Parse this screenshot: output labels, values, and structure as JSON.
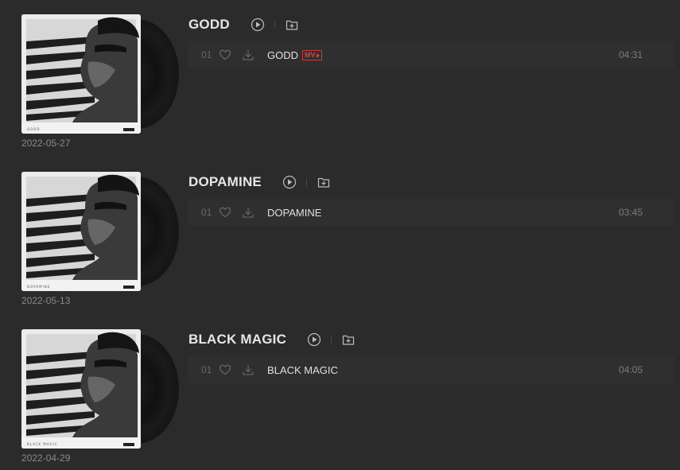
{
  "albums": [
    {
      "title": "GODD",
      "cover_caption": "GODD",
      "release_date": "2022-05-27",
      "tracks": [
        {
          "number": "01",
          "name": "GODD",
          "has_mv": true,
          "mv_label": "MV",
          "duration": "04:31"
        }
      ]
    },
    {
      "title": "DOPAMINE",
      "cover_caption": "DOPAMINE",
      "release_date": "2022-05-13",
      "tracks": [
        {
          "number": "01",
          "name": "DOPAMINE",
          "has_mv": false,
          "duration": "03:45"
        }
      ]
    },
    {
      "title": "BLACK MAGIC",
      "cover_caption": "BLACK MAGIC",
      "release_date": "2022-04-29",
      "tracks": [
        {
          "number": "01",
          "name": "BLACK MAGIC",
          "has_mv": false,
          "duration": "04:05"
        }
      ]
    }
  ],
  "icons": {
    "play": "play-circle-icon",
    "add": "add-to-playlist-icon",
    "like": "heart-icon",
    "download": "download-icon"
  },
  "colors": {
    "background": "#2b2b2b",
    "row_background": "#2f2f2f",
    "mv_accent": "#e04040"
  }
}
